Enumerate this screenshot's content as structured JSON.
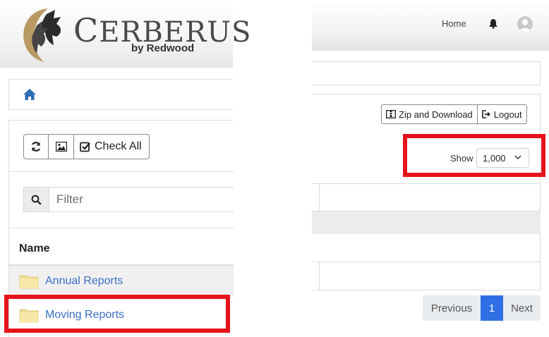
{
  "brand": {
    "name_first": "C",
    "name_rest": "ERBERUS",
    "tagline": "by Redwood"
  },
  "left": {
    "toolbar": {
      "check_all_label": "Check All"
    },
    "filter": {
      "placeholder": "Filter"
    },
    "table": {
      "header": "Name",
      "rows": [
        {
          "label": "Annual Reports",
          "icon": "folder-icon"
        },
        {
          "label": "Moving Reports",
          "icon": "folder-icon"
        }
      ]
    }
  },
  "right": {
    "navbar": {
      "home_label": "Home",
      "icons": [
        "bell-icon",
        "avatar"
      ]
    },
    "actions": {
      "zip_label": "Zip and Download",
      "logout_label": "Logout"
    },
    "show": {
      "label": "Show",
      "selected": "1,000"
    },
    "pagination": {
      "previous": "Previous",
      "current": "1",
      "next": "Next"
    }
  },
  "colors": {
    "highlight": "#e6131b",
    "link": "#3d6fc7",
    "active_page": "#2f6fe4"
  }
}
